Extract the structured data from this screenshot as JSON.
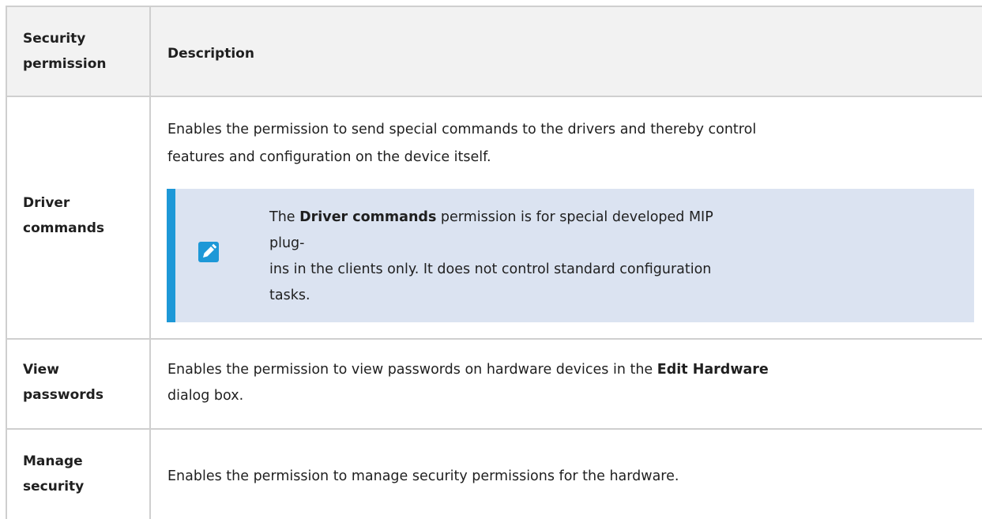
{
  "header": {
    "col1_line1": "Security",
    "col1_line2": "permission",
    "col2": "Description"
  },
  "rows": [
    {
      "permission_line1": "Driver",
      "permission_line2": "commands",
      "desc_line1": "Enables the permission to send special commands to the drivers and thereby control",
      "desc_line2": "features and configuration on the device itself.",
      "note": {
        "icon": "pencil-note-icon",
        "line1_pre": "The ",
        "line1_bold": "Driver commands",
        "line1_post": " permission is for special developed MIP plug-",
        "line2": "ins in the clients only. It does not control standard configuration",
        "line3": "tasks."
      }
    },
    {
      "permission_line1": "View",
      "permission_line2": "passwords",
      "desc_line1_pre": "Enables the permission to view passwords on hardware devices in the ",
      "desc_line1_bold": "Edit Hardware",
      "desc_line2": "dialog box."
    },
    {
      "permission_line1": "Manage",
      "permission_line2": "security",
      "desc_line1": "Enables the permission to manage security permissions for the hardware."
    }
  ],
  "colors": {
    "header_bg": "#f2f2f2",
    "note_bg": "#dbe3f1",
    "note_accent": "#1d98d7",
    "border": "#cfcfcf"
  }
}
